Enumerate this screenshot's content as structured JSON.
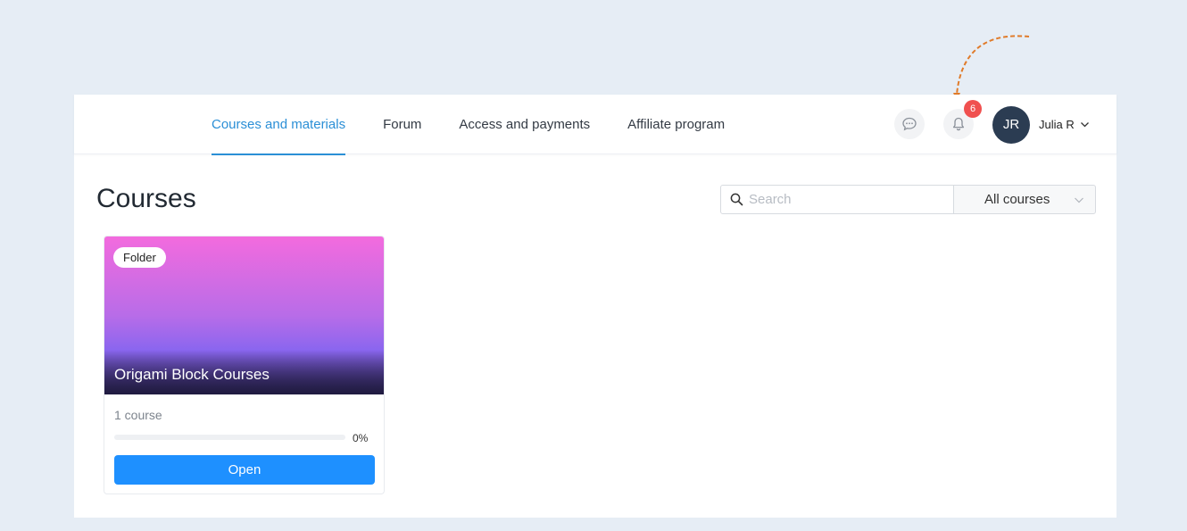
{
  "nav": {
    "tabs": [
      {
        "label": "Courses and materials",
        "active": true
      },
      {
        "label": "Forum",
        "active": false
      },
      {
        "label": "Access and payments",
        "active": false
      },
      {
        "label": "Affiliate program",
        "active": false
      }
    ]
  },
  "header": {
    "chat_icon": "chat-bubble-icon",
    "bell_icon": "bell-icon",
    "notification_count": "6",
    "avatar_initials": "JR",
    "user_name": "Julia R"
  },
  "main": {
    "title": "Courses",
    "search": {
      "placeholder": "Search",
      "value": ""
    },
    "filter": {
      "selected": "All courses"
    }
  },
  "cards": [
    {
      "tag": "Folder",
      "title": "Origami Block Courses",
      "count_label": "1 course",
      "progress": 0,
      "progress_label": "0%",
      "button_label": "Open"
    }
  ],
  "colors": {
    "accent": "#2b8fd6",
    "button": "#1e90ff",
    "badge": "#f0504f",
    "avatar": "#2b3c52",
    "background": "#e6edf5",
    "annotation": "#e07b2a"
  }
}
